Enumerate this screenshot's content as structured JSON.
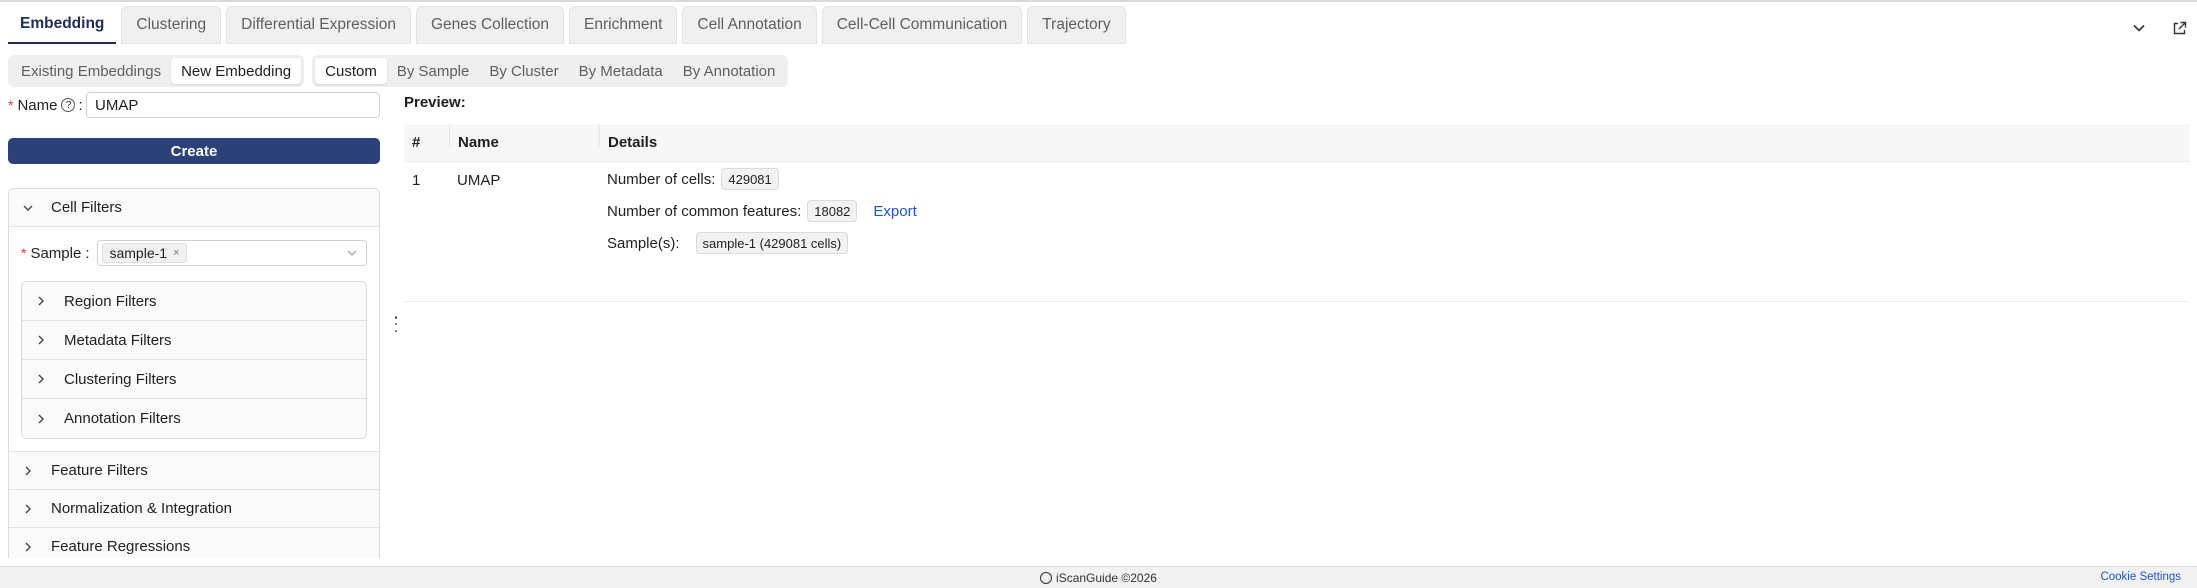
{
  "tabs": [
    {
      "label": "Embedding",
      "active": true
    },
    {
      "label": "Clustering"
    },
    {
      "label": "Differential Expression"
    },
    {
      "label": "Genes Collection"
    },
    {
      "label": "Enrichment"
    },
    {
      "label": "Cell Annotation"
    },
    {
      "label": "Cell-Cell Communication"
    },
    {
      "label": "Trajectory"
    }
  ],
  "icons": {
    "collapse": "chevron-down-icon",
    "popout": "external-link-icon"
  },
  "mode_toggle": {
    "existing": "Existing Embeddings",
    "new": "New Embedding",
    "selected": "New Embedding"
  },
  "sub_tabs": {
    "custom": "Custom",
    "by_sample": "By Sample",
    "by_cluster": "By Cluster",
    "by_metadata": "By Metadata",
    "by_annotation": "By Annotation",
    "selected": "Custom"
  },
  "form": {
    "required_mark": "*",
    "name_label": "Name",
    "help_glyph": "?",
    "colon": ":",
    "name_value": "UMAP",
    "create_label": "Create"
  },
  "cell_filters": {
    "title": "Cell Filters",
    "sample_label": "Sample",
    "sample_tag": "sample-1",
    "tag_remove": "×",
    "subfilters": [
      "Region Filters",
      "Metadata Filters",
      "Clustering Filters",
      "Annotation Filters"
    ]
  },
  "sections": [
    "Feature Filters",
    "Normalization & Integration",
    "Feature Regressions"
  ],
  "preview": {
    "title": "Preview:",
    "columns": {
      "num": "#",
      "name": "Name",
      "details": "Details"
    },
    "row": {
      "num": "1",
      "name": "UMAP",
      "cells_label": "Number of cells:",
      "cells_value": "429081",
      "features_label": "Number of common features:",
      "features_value": "18082",
      "export_label": "Export",
      "samples_label": "Sample(s):",
      "samples_value": "sample-1 (429081 cells)"
    }
  },
  "footer": {
    "brand": "iScanGuide ©2026",
    "cookie": "Cookie Settings"
  },
  "colors": {
    "primary": "#2c4177",
    "link": "#1a56db",
    "required": "#e53935"
  }
}
